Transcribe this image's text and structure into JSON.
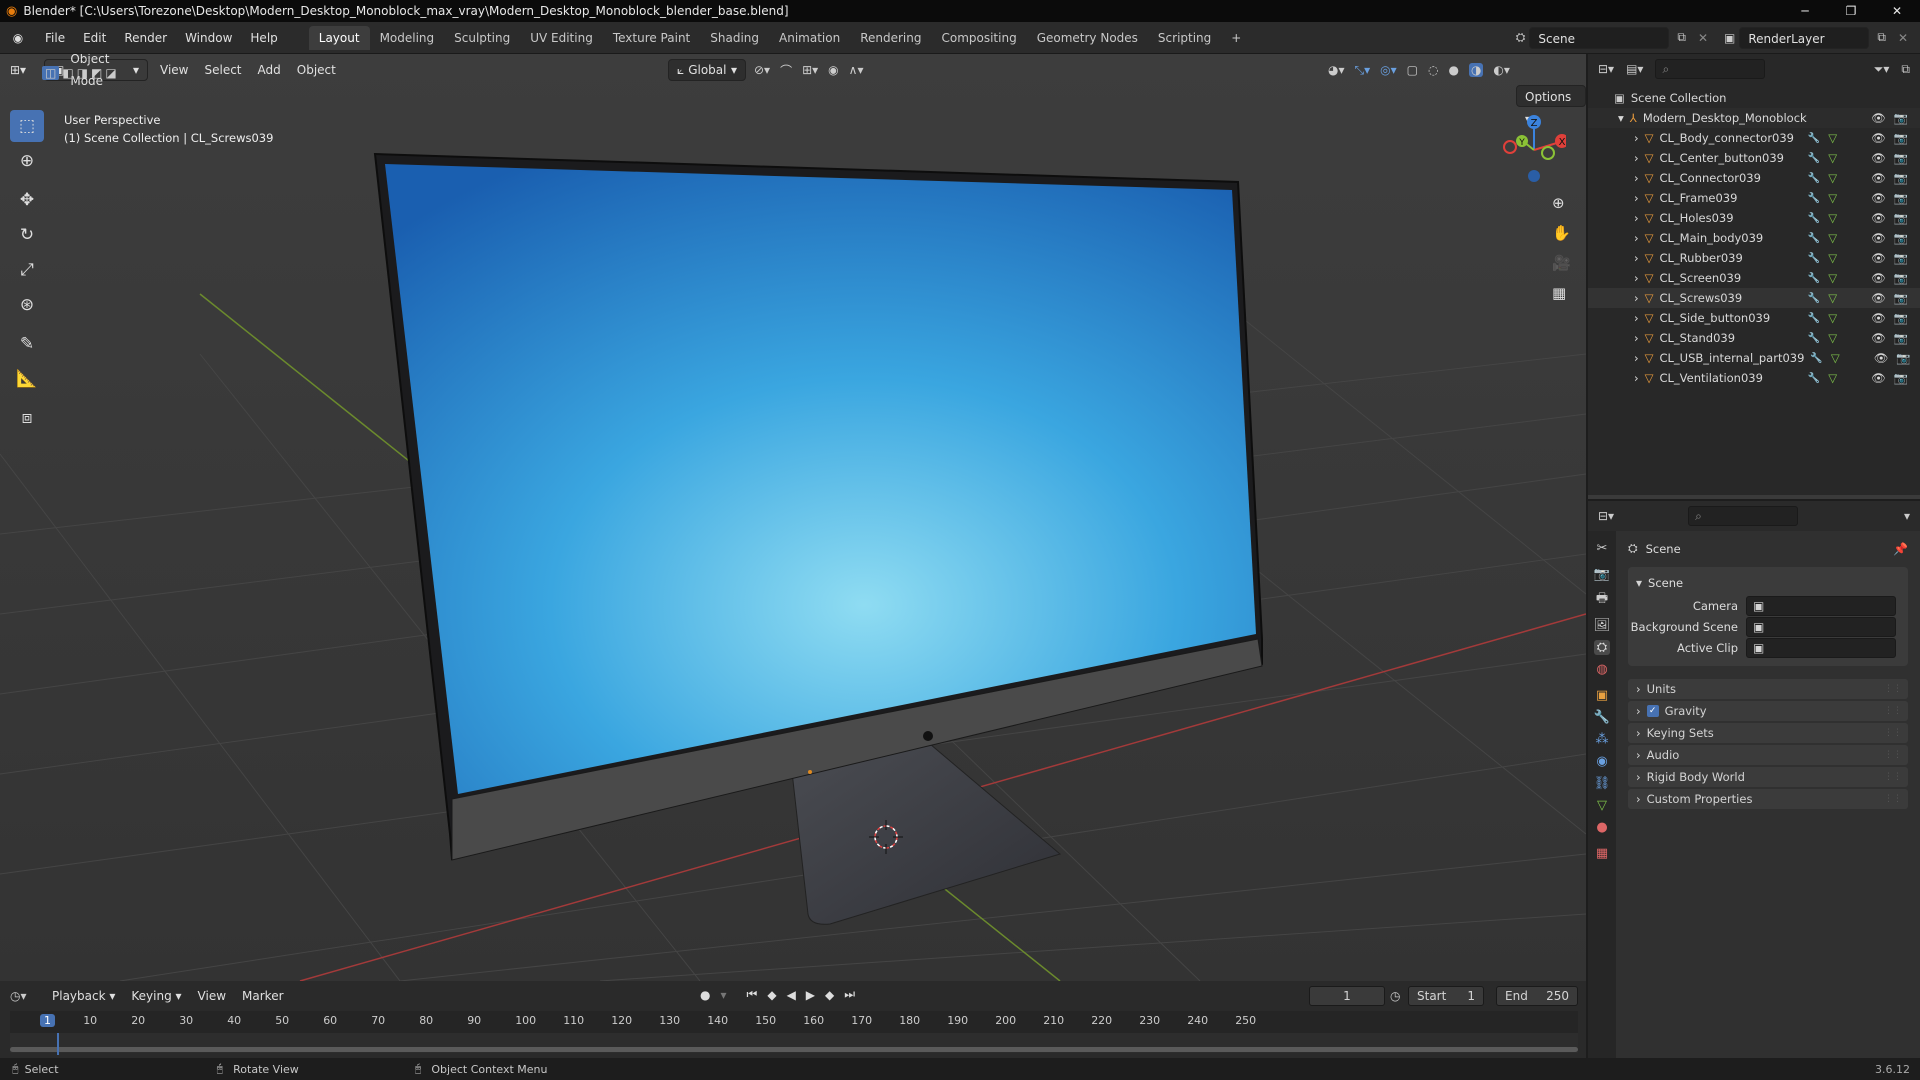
{
  "titlebar": {
    "title": "Blender* [C:\\Users\\Torezone\\Desktop\\Modern_Desktop_Monoblock_max_vray\\Modern_Desktop_Monoblock_blender_base.blend]"
  },
  "menubar": {
    "menus": [
      "File",
      "Edit",
      "Render",
      "Window",
      "Help"
    ],
    "workspaces": [
      "Layout",
      "Modeling",
      "Sculpting",
      "UV Editing",
      "Texture Paint",
      "Shading",
      "Animation",
      "Rendering",
      "Compositing",
      "Geometry Nodes",
      "Scripting"
    ],
    "active_workspace": "Layout",
    "add_workspace": "+",
    "scene_name": "Scene",
    "view_layer": "RenderLayer"
  },
  "viewport": {
    "mode": "Object Mode",
    "menus": [
      "View",
      "Select",
      "Add",
      "Object"
    ],
    "transform_orientation": "Global",
    "options_label": "Options",
    "overlay_title": "User Perspective",
    "overlay_subtitle": "(1) Scene Collection | CL_Screws039",
    "gizmo_axes": {
      "x": "X",
      "y": "Y",
      "z": "Z"
    },
    "colors": {
      "x_axis": "#e0403a",
      "y_axis": "#8bc236",
      "z_axis": "#3b83dd",
      "active_tool": "#4772b3"
    }
  },
  "outliner": {
    "root": "Scene Collection",
    "collection": "Modern_Desktop_Monoblock",
    "objects": [
      "CL_Body_connector039",
      "CL_Center_button039",
      "CL_Connector039",
      "CL_Frame039",
      "CL_Holes039",
      "CL_Main_body039",
      "CL_Rubber039",
      "CL_Screen039",
      "CL_Screws039",
      "CL_Side_button039",
      "CL_Stand039",
      "CL_USB_internal_part039",
      "CL_Ventilation039"
    ],
    "selected": "CL_Screws039"
  },
  "properties": {
    "header": "Scene",
    "panel": "Scene",
    "fields": [
      {
        "label": "Camera",
        "value": ""
      },
      {
        "label": "Background Scene",
        "value": ""
      },
      {
        "label": "Active Clip",
        "value": ""
      }
    ],
    "sections": [
      "Units",
      "Gravity",
      "Keying Sets",
      "Audio",
      "Rigid Body World",
      "Custom Properties"
    ],
    "gravity_checked": true
  },
  "timeline": {
    "menus": [
      "Playback",
      "Keying",
      "View",
      "Marker"
    ],
    "current_frame": "1",
    "start_label": "Start",
    "start": "1",
    "end_label": "End",
    "end": "250",
    "ticks": [
      "1",
      "10",
      "20",
      "30",
      "40",
      "50",
      "60",
      "70",
      "80",
      "90",
      "100",
      "110",
      "120",
      "130",
      "140",
      "150",
      "160",
      "170",
      "180",
      "190",
      "200",
      "210",
      "220",
      "230",
      "240",
      "250"
    ]
  },
  "statusbar": {
    "select": "Select",
    "rotate": "Rotate View",
    "context": "Object Context Menu",
    "version": "3.6.12"
  }
}
